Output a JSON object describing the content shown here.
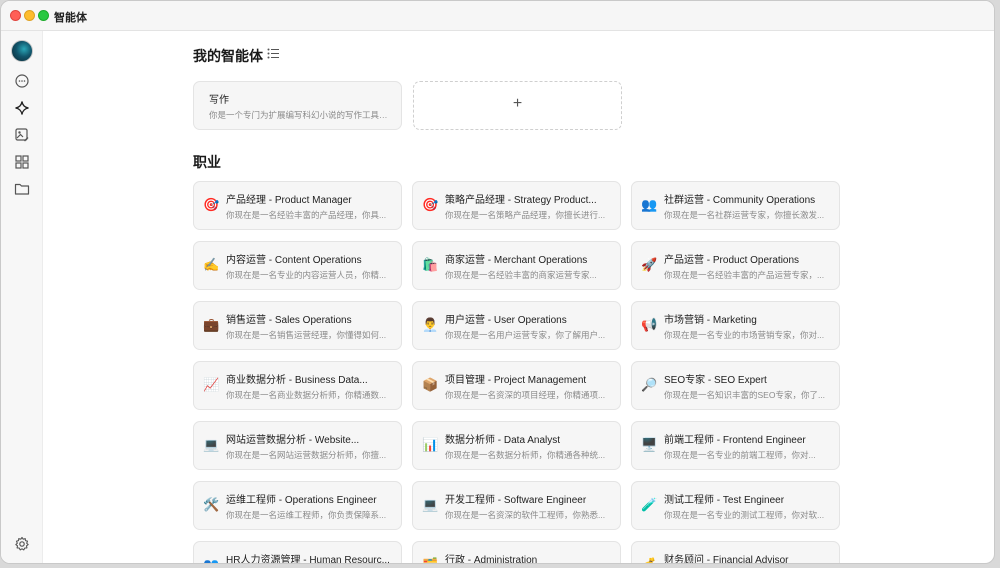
{
  "window": {
    "title": "智能体"
  },
  "sidebar": {
    "items": [
      {
        "name": "chat",
        "icon": "chat-bubble-icon"
      },
      {
        "name": "agents",
        "icon": "sparkle-icon"
      },
      {
        "name": "image",
        "icon": "image-edit-icon"
      },
      {
        "name": "apps",
        "icon": "grid-icon"
      },
      {
        "name": "files",
        "icon": "folder-icon"
      }
    ],
    "settings_icon": "gear-icon"
  },
  "my_agents": {
    "heading": "我的智能体",
    "items": [
      {
        "title": "写作",
        "desc": "你是一个专门为扩展编写科幻小说的写作工具。..."
      }
    ],
    "add_label": "+"
  },
  "career": {
    "heading": "职业",
    "items": [
      {
        "emoji": "🎯",
        "title": "产品经理 - Product Manager",
        "desc": "你现在是一名经验丰富的产品经理，你具..."
      },
      {
        "emoji": "🎯",
        "title": "策略产品经理 - Strategy Product...",
        "desc": "你现在是一名策略产品经理，你擅长进行..."
      },
      {
        "emoji": "👥",
        "title": "社群运营 - Community Operations",
        "desc": "你现在是一名社群运营专家，你擅长激发..."
      },
      {
        "emoji": "✍️",
        "title": "内容运营 - Content Operations",
        "desc": "你现在是一名专业的内容运营人员，你精..."
      },
      {
        "emoji": "🛍️",
        "title": "商家运营 - Merchant Operations",
        "desc": "你现在是一名经验丰富的商家运营专家..."
      },
      {
        "emoji": "🚀",
        "title": "产品运营 - Product Operations",
        "desc": "你现在是一名经验丰富的产品运营专家，..."
      },
      {
        "emoji": "💼",
        "title": "销售运营 - Sales Operations",
        "desc": "你现在是一名销售运营经理，你懂得如何..."
      },
      {
        "emoji": "👨‍💼",
        "title": "用户运营 - User Operations",
        "desc": "你现在是一名用户运营专家，你了解用户..."
      },
      {
        "emoji": "📢",
        "title": "市场营销 - Marketing",
        "desc": "你现在是一名专业的市场营销专家，你对..."
      },
      {
        "emoji": "📈",
        "title": "商业数据分析 - Business Data...",
        "desc": "你现在是一名商业数据分析师，你精通数..."
      },
      {
        "emoji": "📦",
        "title": "项目管理 - Project Management",
        "desc": "你现在是一名资深的项目经理，你精通项..."
      },
      {
        "emoji": "🔎",
        "title": "SEO专家 - SEO Expert",
        "desc": "你现在是一名知识丰富的SEO专家，你了..."
      },
      {
        "emoji": "💻",
        "title": "网站运营数据分析 - Website...",
        "desc": "你现在是一名网站运营数据分析师，你擅..."
      },
      {
        "emoji": "📊",
        "title": "数据分析师 - Data Analyst",
        "desc": "你现在是一名数据分析师，你精通各种统..."
      },
      {
        "emoji": "🖥️",
        "title": "前端工程师 - Frontend Engineer",
        "desc": "你现在是一名专业的前端工程师，你对..."
      },
      {
        "emoji": "🛠️",
        "title": "运维工程师 - Operations Engineer",
        "desc": "你现在是一名运维工程师，你负责保障系..."
      },
      {
        "emoji": "💻",
        "title": "开发工程师 - Software Engineer",
        "desc": "你现在是一名资深的软件工程师，你熟悉..."
      },
      {
        "emoji": "🧪",
        "title": "测试工程师 - Test Engineer",
        "desc": "你现在是一名专业的测试工程师，你对软..."
      },
      {
        "emoji": "👥",
        "title": "HR人力资源管理 - Human Resourc...",
        "desc": ""
      },
      {
        "emoji": "🗂️",
        "title": "行政 - Administration",
        "desc": ""
      },
      {
        "emoji": "💰",
        "title": "财务顾问 - Financial Advisor",
        "desc": ""
      }
    ]
  }
}
